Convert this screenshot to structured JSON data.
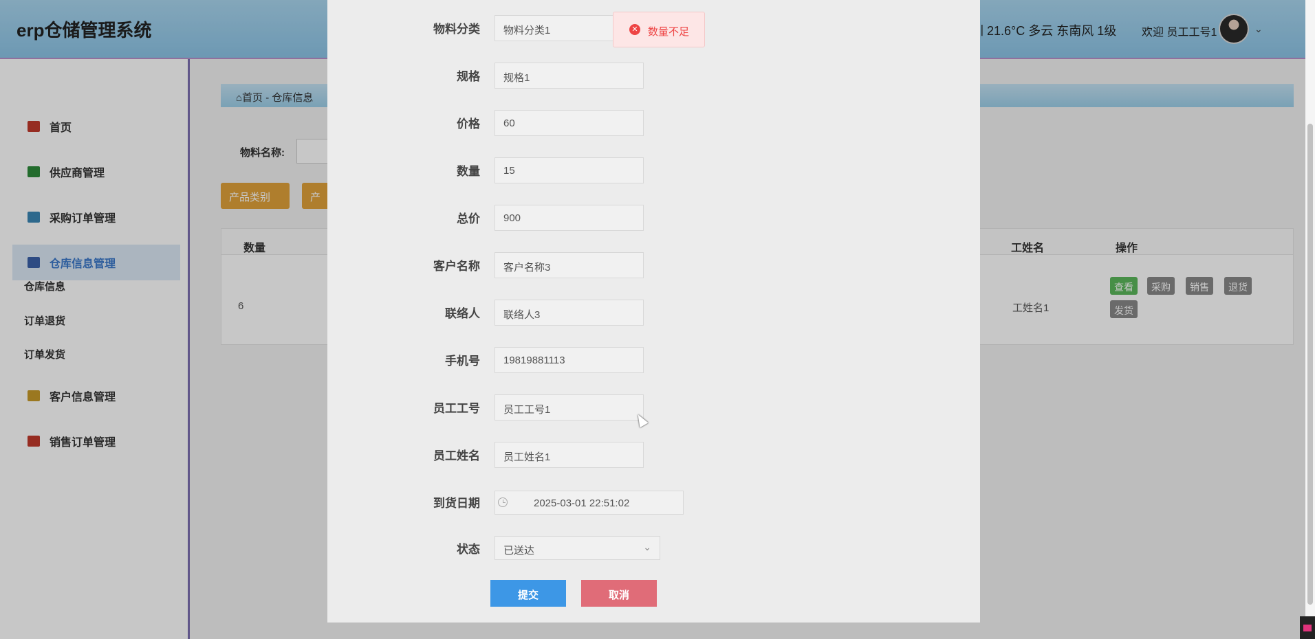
{
  "header": {
    "title": "erp仓储管理系统",
    "weather": "圳 21.6°C 多云 东南风 1级",
    "welcome": "欢迎 员工工号1"
  },
  "sidebar": {
    "items": [
      {
        "label": "首页",
        "icon": "home-icon",
        "color": "#c0392b"
      },
      {
        "label": "供应商管理",
        "icon": "supplier-icon",
        "color": "#2e8b3a"
      },
      {
        "label": "采购订单管理",
        "icon": "purchase-icon",
        "color": "#3a86b4"
      },
      {
        "label": "仓库信息管理",
        "icon": "chart-icon",
        "color": "#3a60a8"
      },
      {
        "label": "客户信息管理",
        "icon": "briefcase-icon",
        "color": "#c79a2a"
      },
      {
        "label": "销售订单管理",
        "icon": "sales-icon",
        "color": "#c0392b"
      }
    ],
    "sub_items": [
      "仓库信息",
      "订单退货",
      "订单发货"
    ]
  },
  "main": {
    "breadcrumb": "⌂首页 - 仓库信息",
    "search_label": "物料名称:",
    "category_buttons": [
      "产品类别",
      "产"
    ],
    "table": {
      "headers": [
        "数量",
        "工姓名",
        "操作"
      ],
      "row": {
        "qty": "6",
        "staff": "工姓名1"
      },
      "actions": [
        "查看",
        "采购",
        "销售",
        "退货",
        "发货"
      ]
    }
  },
  "modal": {
    "fields": [
      {
        "label": "物料分类",
        "value": "物料分类1"
      },
      {
        "label": "规格",
        "value": "规格1"
      },
      {
        "label": "价格",
        "value": "60"
      },
      {
        "label": "数量",
        "value": "15"
      },
      {
        "label": "总价",
        "value": "900"
      },
      {
        "label": "客户名称",
        "value": "客户名称3"
      },
      {
        "label": "联络人",
        "value": "联络人3"
      },
      {
        "label": "手机号",
        "value": "19819881113"
      },
      {
        "label": "员工工号",
        "value": "员工工号1"
      },
      {
        "label": "员工姓名",
        "value": "员工姓名1"
      }
    ],
    "date_label": "到货日期",
    "date_value": "2025-03-01 22:51:02",
    "status_label": "状态",
    "status_value": "已送达",
    "submit": "提交",
    "cancel": "取消"
  },
  "toast": {
    "message": "数量不足",
    "icon": "error-circle-icon"
  }
}
